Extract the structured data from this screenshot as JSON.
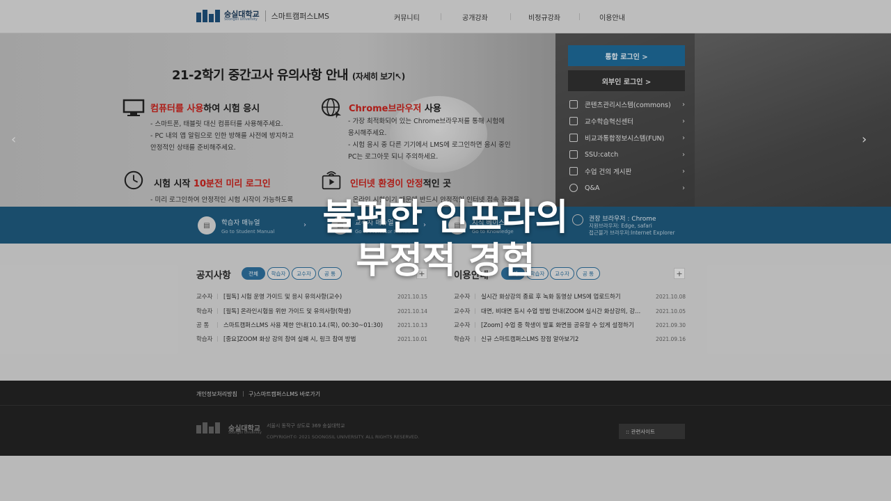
{
  "header": {
    "logo_kr": "숭실대학교",
    "logo_en": "Soongsil University",
    "site_name": "스마트캠퍼스LMS",
    "nav": [
      "커뮤니티",
      "공개강좌",
      "비정규강좌",
      "이용안내"
    ]
  },
  "hero": {
    "title": "21-2학기 중간고사 유의사항 안내",
    "title_more": "(자세히 보기",
    "blocks": [
      {
        "icon": "monitor-icon",
        "heading_red": "컴퓨터를 사용",
        "heading_rest": "하여 시험 응시",
        "lines": [
          "- 스마트폰, 태블릿 대신 컴퓨터를 사용해주세요.",
          "- PC 내의 앱 알림으로 인한 방해를 사전에 방지하고",
          "  안정적인 상태를 준비해주세요."
        ]
      },
      {
        "icon": "globe-icon",
        "heading_red": "Chrome브라우저",
        "heading_rest": " 사용",
        "lines": [
          "- 가장 최적화되어 있는 Chrome브라우저를 통해 시험에",
          "  응시해주세요.",
          "- 시험 응시 중 다른 기기에서 LMS에 로그인하면 응시 중인",
          "  PC는 로그아웃 되니 주의하세요."
        ]
      },
      {
        "icon": "clock-icon",
        "heading_pre": "시험 시작 ",
        "heading_red": "10분전 미리 로그인",
        "heading_rest": "",
        "lines": [
          "- 미리 로그인하여 안정적인 시험 시작이 가능하도록"
        ]
      },
      {
        "icon": "wifi-play-icon",
        "heading_red": "인터넷 환경이 안정",
        "heading_rest": "적인 곳",
        "lines": [
          "- 온라인 시험이기 때문에 반드시 안정적인 인터넷 접속 환경을"
        ]
      }
    ]
  },
  "login": {
    "integrated": "통합 로그인 >",
    "external": "외부인 로그인 >",
    "systems": [
      "콘텐츠관리시스템(commons)",
      "교수학습혁신센터",
      "비교과통합정보시스템(FUN)",
      "SSU:catch",
      "수업 건의 게시판",
      "Q&A"
    ]
  },
  "strip": {
    "manuals": [
      {
        "title": "학습자 매뉴얼",
        "sub": "Go to Student Manual"
      },
      {
        "title": "교수자 매뉴얼",
        "sub": "Go to Professor Manual"
      },
      {
        "title": "지식 베이스",
        "sub": "Go to Knowledge"
      }
    ],
    "browser_title": "권장 브라우저 : Chrome",
    "browser_supported": "지원브라우저: Edge, safari",
    "browser_unsupported": "접근불가 브라우저:Internet Explorer"
  },
  "notices": {
    "title": "공지사항",
    "tabs": [
      "전체",
      "학습자",
      "교수자",
      "공 통"
    ],
    "rows": [
      {
        "cat": "교수자",
        "title": "[필독] 시험 운영 가이드 및 응시 유의사항(교수)",
        "date": "2021.10.15"
      },
      {
        "cat": "학습자",
        "title": "[필독] 온라인시험을 위한 가이드 및 유의사항(학생)",
        "date": "2021.10.14"
      },
      {
        "cat": "공 통",
        "title": "스마트캠퍼스LMS 사용 제한 안내(10.14.(목), 00:30~01:30)",
        "date": "2021.10.13"
      },
      {
        "cat": "학습자",
        "title": "[중요]ZOOM 화상 강의 참여 실패 시, 링크 참여 방법",
        "date": "2021.10.01"
      }
    ]
  },
  "guide": {
    "title": "이용안내",
    "tabs": [
      "전체",
      "학습자",
      "교수자",
      "공 통"
    ],
    "rows": [
      {
        "cat": "교수자",
        "title": "실시간 화상강의 종료 후 녹화 동영상 LMS에 업로드하기",
        "date": "2021.10.08"
      },
      {
        "cat": "교수자",
        "title": "대면, 비대면 동시 수업 방법 안내(ZOOM 실시간 화상강의, 강...",
        "date": "2021.10.05"
      },
      {
        "cat": "교수자",
        "title": "[Zoom] 수업 중 학생이 발표 화면을 공유할 수 있게 설정하기",
        "date": "2021.09.30"
      },
      {
        "cat": "학습자",
        "title": "신규 스마트캠퍼스LMS 장점 알아보기2",
        "date": "2021.09.16"
      }
    ]
  },
  "footer": {
    "privacy": "개인정보처리방침",
    "old_site": "구)스마트캠퍼스LMS 바로가기",
    "address": "서울시 동작구 상도로 369 숭실대학교",
    "copyright": "COPYRIGHT© 2021 SOONGSIL UNIVERSITY. ALL RIGHTS RESERVED.",
    "related": ":: 관련사이트"
  },
  "overlay": {
    "line1": "불편한 인프라의",
    "line2": "부정적 경험"
  },
  "colors": {
    "accent_blue": "#1e6a99",
    "strip_blue": "#1f5a7e",
    "highlight_red": "#c9221c",
    "footer_dark": "#232323"
  }
}
